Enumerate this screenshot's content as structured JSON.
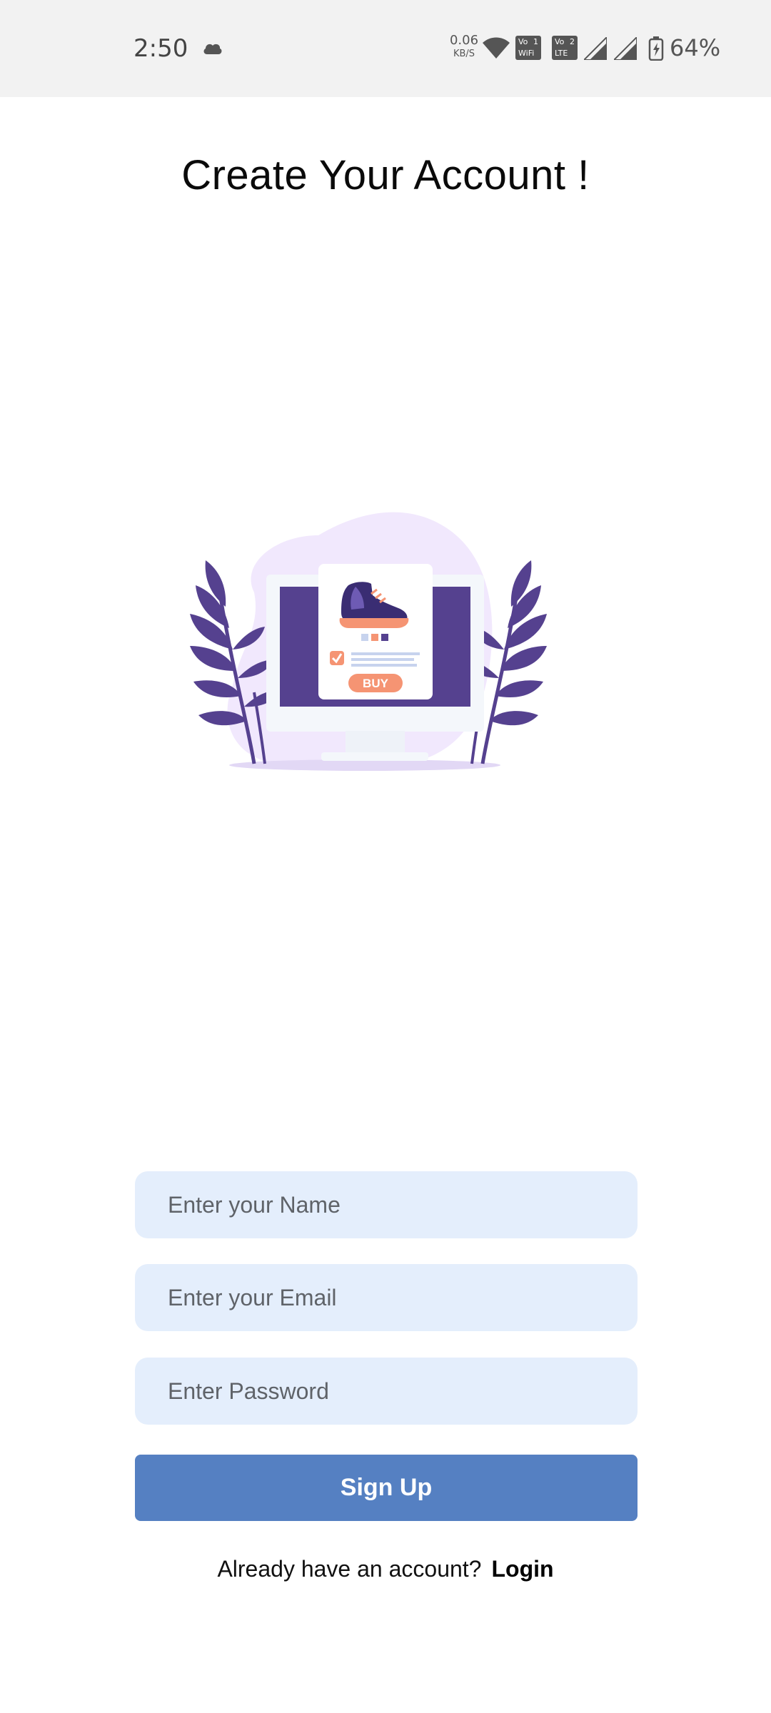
{
  "status_bar": {
    "time": "2:50",
    "net_speed_value": "0.06",
    "net_speed_unit": "KB/S",
    "sim1_label_top": "Vo",
    "sim1_label_bottom": "WiFi",
    "sim1_index": "1",
    "sim2_label_top": "Vo",
    "sim2_label_bottom": "LTE",
    "sim2_index": "2",
    "battery_percent": "64%",
    "icons": [
      "cloud-icon",
      "wifi-icon",
      "vowifi-icon",
      "volte-icon",
      "signal-icon",
      "signal-icon",
      "battery-charging-icon"
    ]
  },
  "page": {
    "title": "Create Your Account !"
  },
  "illustration": {
    "buy_label": "BUY",
    "colors": {
      "purple": "#55418f",
      "blob": "#f1e8fd",
      "orange": "#f59473",
      "monitor": "#f4f7fb"
    }
  },
  "form": {
    "name_placeholder": "Enter your Name",
    "email_placeholder": "Enter your Email",
    "password_placeholder": "Enter Password",
    "signup_label": "Sign Up",
    "login_prompt": "Already have an account?",
    "login_label": "Login"
  },
  "colors": {
    "input_bg": "#e4eefc",
    "button_bg": "#5580c2",
    "status_bar_bg": "#f2f2f2"
  }
}
